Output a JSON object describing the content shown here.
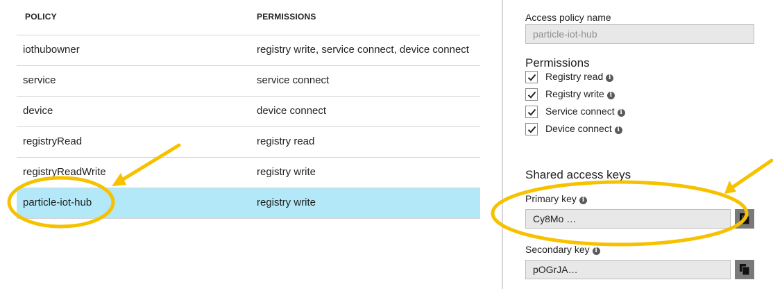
{
  "policies_table": {
    "headers": {
      "policy": "POLICY",
      "permissions": "PERMISSIONS"
    },
    "rows": [
      {
        "policy": "iothubowner",
        "permissions": "registry write, service connect, device connect"
      },
      {
        "policy": "service",
        "permissions": "service connect"
      },
      {
        "policy": "device",
        "permissions": "device connect"
      },
      {
        "policy": "registryRead",
        "permissions": "registry read"
      },
      {
        "policy": "registryReadWrite",
        "permissions": "registry write"
      },
      {
        "policy": "particle-iot-hub",
        "permissions": "registry write"
      }
    ],
    "selected_row": "particle-iot-hub"
  },
  "detail": {
    "policy_name_label": "Access policy name",
    "policy_name_value": "particle-iot-hub",
    "permissions_title": "Permissions",
    "permissions": [
      {
        "label": "Registry read",
        "checked": true
      },
      {
        "label": "Registry write",
        "checked": true
      },
      {
        "label": "Service connect",
        "checked": true
      },
      {
        "label": "Device connect",
        "checked": true
      }
    ],
    "keys_title": "Shared access keys",
    "primary_key_label": "Primary key",
    "primary_key_value": "Cy8Mo …",
    "secondary_key_label": "Secondary key",
    "secondary_key_value": "pOGrJA…"
  },
  "icons": {
    "info": "info-icon",
    "checkmark": "checkmark-icon",
    "copy": "copy-icon"
  },
  "colors": {
    "selected_row": "#b2e8f7",
    "annotation": "#f6c200",
    "field_bg": "#e8e8e8",
    "copy_button": "#7a7a7a"
  }
}
